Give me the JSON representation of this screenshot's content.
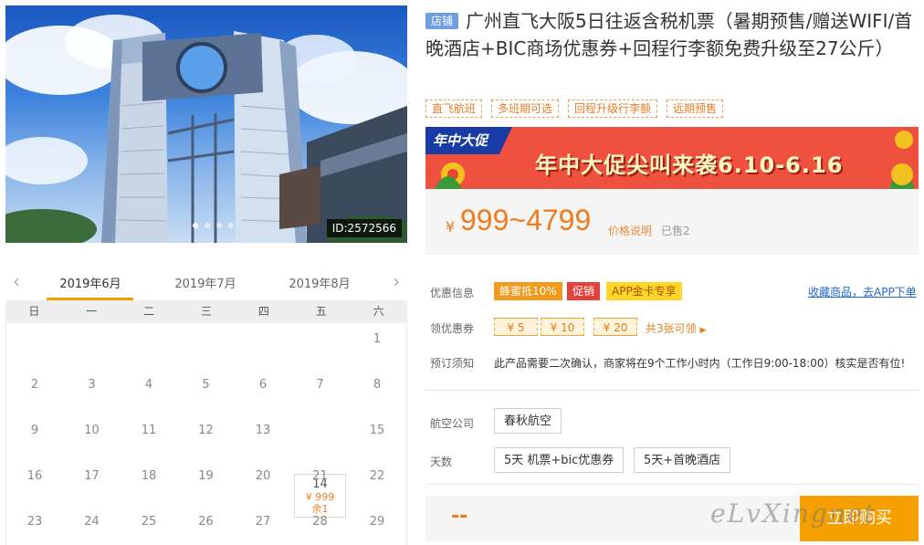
{
  "photo": {
    "id_label": "ID:2572566",
    "slide_count": 4,
    "active_slide": 1
  },
  "product": {
    "shop_badge": "店铺",
    "title": "广州直飞大阪5日往返含税机票（暑期预售/赠送WIFI/首晚酒店+BIC商场优惠券+回程行李额免费升级至27公斤）",
    "tags": [
      "直飞航班",
      "多班期可选",
      "回程升级行李额",
      "远期预售"
    ]
  },
  "banner": {
    "logo_text": "年中大促",
    "headline": "年中大促尖叫来袭6.10-6.16"
  },
  "price": {
    "currency": "¥",
    "value": "999~4799",
    "note_link": "价格说明",
    "sold": "已售2"
  },
  "offers": {
    "label": "优惠信息",
    "tags": [
      "蜂蜜抵10%",
      "促销",
      "APP金卡专享"
    ],
    "app_link": "收藏商品，去APP下单"
  },
  "coupons": {
    "label": "领优惠券",
    "items": [
      "¥ 5",
      "¥ 10",
      "¥ 20"
    ],
    "more": "共3张可领"
  },
  "booking": {
    "label": "预订须知",
    "text": "此产品需要二次确认，商家将在9个工作小时内（工作日9:00-18:00）核实是否有位!"
  },
  "airline": {
    "label": "航空公司",
    "options": [
      "春秋航空"
    ]
  },
  "days": {
    "label": "天数",
    "options": [
      "5天 机票+bic优惠券",
      "5天+首晚酒店"
    ]
  },
  "buy": {
    "price_placeholder": "--",
    "button_label": "立即购买",
    "watermark": "eLvXingnet"
  },
  "calendar": {
    "months": [
      "2019年6月",
      "2019年7月",
      "2019年8月"
    ],
    "active_month": "2019年6月",
    "weekdays": [
      "日",
      "一",
      "二",
      "三",
      "四",
      "五",
      "六"
    ],
    "rows": [
      [
        "",
        "",
        "",
        "",
        "",
        "",
        "1"
      ],
      [
        "2",
        "3",
        "4",
        "5",
        "6",
        "7",
        "8"
      ],
      [
        "9",
        "10",
        "11",
        "12",
        "13",
        "14",
        "15"
      ],
      [
        "16",
        "17",
        "18",
        "19",
        "20",
        "21",
        "22"
      ],
      [
        "23",
        "24",
        "25",
        "26",
        "27",
        "28",
        "29"
      ]
    ],
    "special_day": {
      "day": "14",
      "price": "¥ 999",
      "stock": "余1"
    }
  },
  "colors": {
    "accent": "#f5a000",
    "price": "#f17a1c",
    "banner_red": "#f0503e",
    "banner_blue": "#1a3aa6"
  }
}
